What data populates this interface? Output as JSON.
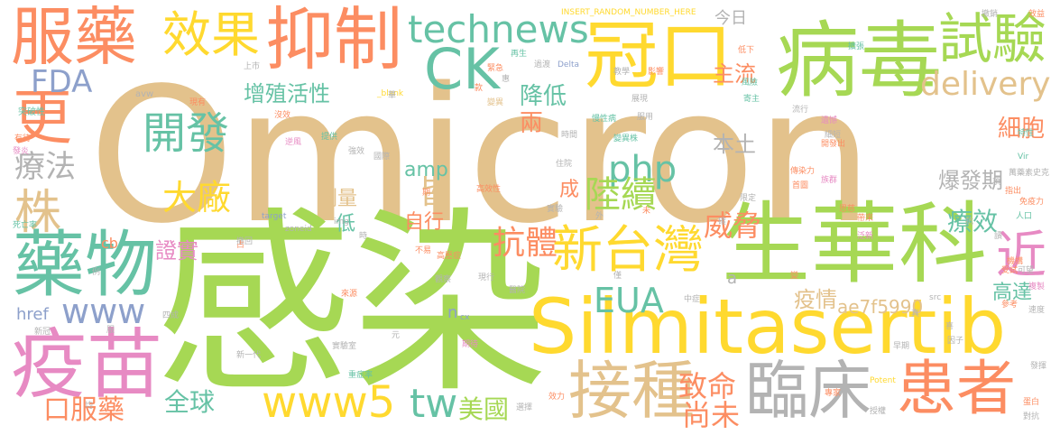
{
  "palette": {
    "tan": "#E3C28C",
    "green": "#A6D854",
    "yellow": "#FFD92F",
    "orange": "#FC8D62",
    "teal": "#66C2A5",
    "pink": "#E78AC3",
    "gray": "#B3B3B3",
    "blue": "#8DA0CB"
  },
  "words": [
    {
      "text": "Omicron",
      "color": "tan"
    },
    {
      "text": "感染",
      "color": "green"
    },
    {
      "text": "Silmitasertib",
      "color": "yellow"
    },
    {
      "text": "病毒",
      "color": "green"
    },
    {
      "text": "生華科",
      "color": "green"
    },
    {
      "text": "冠口",
      "color": "yellow"
    },
    {
      "text": "抑制",
      "color": "orange"
    },
    {
      "text": "服藥",
      "color": "orange"
    },
    {
      "text": "藥物",
      "color": "teal"
    },
    {
      "text": "疫苗",
      "color": "pink"
    },
    {
      "text": "試驗",
      "color": "green"
    },
    {
      "text": "臨床",
      "color": "gray"
    },
    {
      "text": "接種",
      "color": "tan"
    },
    {
      "text": "患者",
      "color": "orange"
    },
    {
      "text": "新台灣",
      "color": "yellow"
    },
    {
      "text": "開發",
      "color": "teal"
    },
    {
      "text": "CK",
      "color": "teal"
    },
    {
      "text": "效果",
      "color": "yellow"
    },
    {
      "text": "更",
      "color": "orange"
    },
    {
      "text": "www5",
      "color": "yellow"
    },
    {
      "text": "technews",
      "color": "teal"
    },
    {
      "text": "株",
      "color": "tan"
    },
    {
      "text": "近",
      "color": "pink"
    },
    {
      "text": "www",
      "color": "blue"
    },
    {
      "text": "tw",
      "color": "teal"
    },
    {
      "text": "php",
      "color": "teal"
    },
    {
      "text": "陸續",
      "color": "green"
    },
    {
      "text": "大廠",
      "color": "yellow"
    },
    {
      "text": "delivery",
      "color": "tan"
    },
    {
      "text": "EUA",
      "color": "teal"
    },
    {
      "text": "抗體",
      "color": "orange"
    },
    {
      "text": "威脅",
      "color": "orange"
    },
    {
      "text": "FDA",
      "color": "blue"
    },
    {
      "text": "療法",
      "color": "gray"
    },
    {
      "text": "致命",
      "color": "orange"
    },
    {
      "text": "尚未",
      "color": "orange"
    },
    {
      "text": "全球",
      "color": "teal"
    },
    {
      "text": "美國",
      "color": "green"
    },
    {
      "text": "療效",
      "color": "teal"
    },
    {
      "text": "細胞",
      "color": "orange"
    },
    {
      "text": "口服藥",
      "color": "orange"
    },
    {
      "text": "皆",
      "color": "tan"
    },
    {
      "text": "降低",
      "color": "teal"
    },
    {
      "text": "兩",
      "color": "orange"
    },
    {
      "text": "主流",
      "color": "orange"
    },
    {
      "text": "增殖活性",
      "color": "teal"
    },
    {
      "text": "本土",
      "color": "gray"
    },
    {
      "text": "爆發期",
      "color": "gray"
    },
    {
      "text": "高達",
      "color": "teal"
    },
    {
      "text": "疫情",
      "color": "tan"
    },
    {
      "text": "ae7f5990",
      "color": "tan"
    },
    {
      "text": "證實",
      "color": "pink"
    },
    {
      "text": "劑量",
      "color": "tan"
    },
    {
      "text": "自行",
      "color": "orange"
    },
    {
      "text": "amp",
      "color": "teal"
    },
    {
      "text": "成",
      "color": "orange"
    },
    {
      "text": "低",
      "color": "teal"
    },
    {
      "text": "今日",
      "color": "gray"
    },
    {
      "text": "href",
      "color": "blue"
    },
    {
      "text": "a",
      "color": "gray"
    },
    {
      "text": "cb",
      "color": "orange"
    },
    {
      "text": "n",
      "color": "blue"
    },
    {
      "text": "INSERT_RANDOM_NUMBER_HERE",
      "color": "yellow"
    },
    {
      "text": "突破性",
      "color": "teal"
    },
    {
      "text": "有待",
      "color": "orange"
    },
    {
      "text": "發炎",
      "color": "pink"
    },
    {
      "text": "死亡率",
      "color": "teal"
    },
    {
      "text": "avw",
      "color": "gray"
    },
    {
      "text": "現有",
      "color": "orange"
    },
    {
      "text": "沒效",
      "color": "orange"
    },
    {
      "text": "逆風",
      "color": "pink"
    },
    {
      "text": "上市",
      "color": "gray"
    },
    {
      "text": "target",
      "color": "blue"
    },
    {
      "text": "img",
      "color": "gray"
    },
    {
      "text": "zoneid",
      "color": "gray"
    },
    {
      "text": "_blank",
      "color": "yellow"
    },
    {
      "text": "Delta",
      "color": "blue"
    },
    {
      "text": "Vir",
      "color": "teal"
    },
    {
      "text": "Potent",
      "color": "yellow"
    },
    {
      "text": "src",
      "color": "gray"
    },
    {
      "text": "cx",
      "color": "blue"
    },
    {
      "text": "撤銷",
      "color": "gray"
    },
    {
      "text": "效益",
      "color": "orange"
    },
    {
      "text": "緊急",
      "color": "orange"
    },
    {
      "text": "再生",
      "color": "teal"
    },
    {
      "text": "低下",
      "color": "orange"
    },
    {
      "text": "過渡",
      "color": "gray"
    },
    {
      "text": "風險",
      "color": "teal"
    },
    {
      "text": "擴張",
      "color": "teal"
    },
    {
      "text": "教學",
      "color": "gray"
    },
    {
      "text": "影響",
      "color": "orange"
    },
    {
      "text": "展現",
      "color": "gray"
    },
    {
      "text": "變異",
      "color": "tan"
    },
    {
      "text": "寄主",
      "color": "teal"
    },
    {
      "text": "慢性病",
      "color": "teal"
    },
    {
      "text": "服用",
      "color": "gray"
    },
    {
      "text": "流行",
      "color": "gray"
    },
    {
      "text": "遺憾",
      "color": "pink"
    },
    {
      "text": "細短",
      "color": "gray"
    },
    {
      "text": "特性",
      "color": "teal"
    },
    {
      "text": "時間",
      "color": "gray"
    },
    {
      "text": "變異株",
      "color": "teal"
    },
    {
      "text": "開發出",
      "color": "orange"
    },
    {
      "text": "傳染力",
      "color": "orange"
    },
    {
      "text": "族群",
      "color": "pink"
    },
    {
      "text": "首圖",
      "color": "orange"
    },
    {
      "text": "限定",
      "color": "gray"
    },
    {
      "text": "恩慈",
      "color": "orange"
    },
    {
      "text": "帶來",
      "color": "orange"
    },
    {
      "text": "指出",
      "color": "orange"
    },
    {
      "text": "免疫力",
      "color": "orange"
    },
    {
      "text": "人口",
      "color": "teal"
    },
    {
      "text": "泛新",
      "color": "pink"
    },
    {
      "text": "可望",
      "color": "gray"
    },
    {
      "text": "機構",
      "color": "orange"
    },
    {
      "text": "發揮",
      "color": "gray"
    },
    {
      "text": "提供",
      "color": "teal"
    },
    {
      "text": "強效",
      "color": "gray"
    },
    {
      "text": "國際",
      "color": "gray"
    },
    {
      "text": "觀世",
      "color": "tan"
    },
    {
      "text": "高效性",
      "color": "orange"
    },
    {
      "text": "住院",
      "color": "gray"
    },
    {
      "text": "實驗",
      "color": "gray"
    },
    {
      "text": "撤回",
      "color": "gray"
    },
    {
      "text": "不易",
      "color": "orange"
    },
    {
      "text": "高壓症",
      "color": "orange"
    },
    {
      "text": "觀察",
      "color": "gray"
    },
    {
      "text": "現行",
      "color": "gray"
    },
    {
      "text": "醫院",
      "color": "gray"
    },
    {
      "text": "中症",
      "color": "gray"
    },
    {
      "text": "來源",
      "color": "orange"
    },
    {
      "text": "新一代",
      "color": "gray"
    },
    {
      "text": "實驗室",
      "color": "gray"
    },
    {
      "text": "期待",
      "color": "pink"
    },
    {
      "text": "重症率",
      "color": "teal"
    },
    {
      "text": "選擇",
      "color": "gray"
    },
    {
      "text": "效力",
      "color": "orange"
    },
    {
      "text": "專家",
      "color": "orange"
    },
    {
      "text": "因子",
      "color": "gray"
    },
    {
      "text": "早期",
      "color": "gray"
    },
    {
      "text": "蛋白",
      "color": "orange"
    },
    {
      "text": "對抗",
      "color": "gray"
    },
    {
      "text": "授權",
      "color": "gray"
    },
    {
      "text": "四成",
      "color": "gray"
    },
    {
      "text": "新冠",
      "color": "gray"
    },
    {
      "text": "速度",
      "color": "gray"
    },
    {
      "text": "複製",
      "color": "pink"
    },
    {
      "text": "受試",
      "color": "orange"
    },
    {
      "text": "參考",
      "color": "orange"
    },
    {
      "text": "萬藥素史克",
      "color": "gray"
    },
    {
      "text": "元",
      "color": "gray"
    },
    {
      "text": "均",
      "color": "gray"
    },
    {
      "text": "服",
      "color": "gray"
    },
    {
      "text": "款",
      "color": "orange"
    },
    {
      "text": "華",
      "color": "gray"
    },
    {
      "text": "期",
      "color": "orange"
    },
    {
      "text": "時",
      "color": "gray"
    },
    {
      "text": "占",
      "color": "orange"
    },
    {
      "text": "例",
      "color": "gray"
    },
    {
      "text": "項",
      "color": "gray"
    },
    {
      "text": "抗",
      "color": "gray"
    },
    {
      "text": "讀",
      "color": "gray"
    },
    {
      "text": "變",
      "color": "orange"
    },
    {
      "text": "真",
      "color": "gray"
    },
    {
      "text": "喜",
      "color": "gray"
    },
    {
      "text": "確",
      "color": "gray"
    },
    {
      "text": "外",
      "color": "gray"
    },
    {
      "text": "僅",
      "color": "gray"
    },
    {
      "text": "未",
      "color": "orange"
    },
    {
      "text": "惠",
      "color": "gray"
    }
  ]
}
